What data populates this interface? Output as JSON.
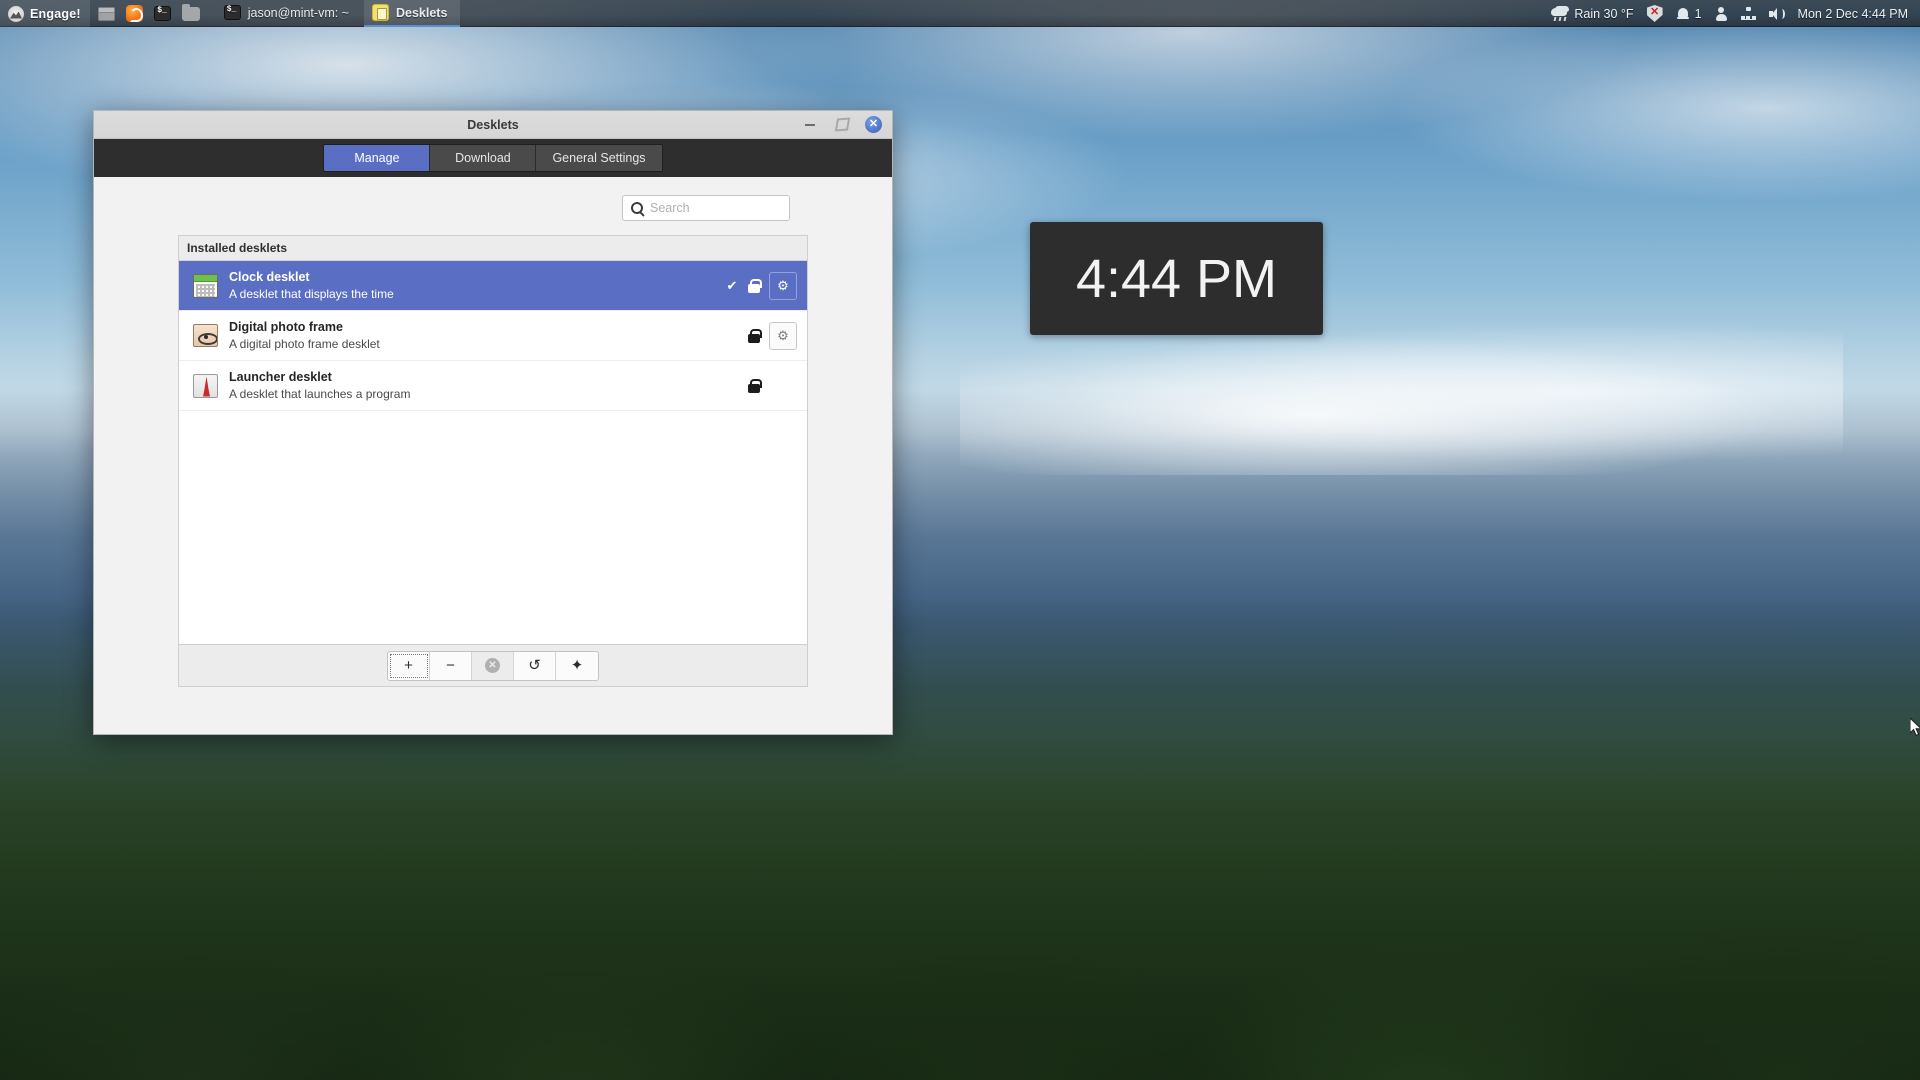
{
  "panel": {
    "menu": {
      "icon": "mint-menu-icon",
      "label": "Engage!"
    },
    "launchers": [
      {
        "name": "launcher-window-list",
        "icon": "window-icon"
      },
      {
        "name": "launcher-firefox",
        "icon": "firefox-icon"
      },
      {
        "name": "launcher-terminal",
        "icon": "terminal-icon"
      },
      {
        "name": "launcher-files",
        "icon": "folder-icon"
      }
    ],
    "windows": [
      {
        "name": "window-button-terminal",
        "icon": "terminal-icon",
        "label": "jason@mint-vm: ~",
        "active": false
      },
      {
        "name": "window-button-desklets",
        "icon": "desklets-icon",
        "label": "Desklets",
        "active": true
      }
    ],
    "tray": {
      "weather_icon": "cloud-rain-icon",
      "weather": "Rain 30 °F",
      "shield_icon": "shield-alert-icon",
      "notifications_icon": "bell-icon",
      "notifications_count": "1",
      "user_icon": "user-icon",
      "network_icon": "network-icon",
      "volume_icon": "volume-icon",
      "clock": "Mon  2 Dec  4:44 PM"
    }
  },
  "clock_desklet": {
    "time": "4:44 PM"
  },
  "window": {
    "title": "Desklets",
    "controls": {
      "minimize": "minimize-button",
      "maximize": "maximize-button",
      "close": "close-button"
    },
    "tabs": [
      {
        "label": "Manage",
        "active": true
      },
      {
        "label": "Download",
        "active": false
      },
      {
        "label": "General Settings",
        "active": false
      }
    ],
    "search": {
      "placeholder": "Search",
      "value": "",
      "icon": "search-icon"
    },
    "list": {
      "header": "Installed desklets",
      "rows": [
        {
          "icon": "clock-desklet-icon",
          "title": "Clock desklet",
          "description": "A desklet that displays the time",
          "selected": true,
          "checked": true,
          "check_glyph": "✔",
          "locked": true,
          "has_config": true,
          "gear_glyph": "⚙"
        },
        {
          "icon": "photo-frame-desklet-icon",
          "title": "Digital photo frame",
          "description": "A digital photo frame desklet",
          "selected": false,
          "checked": false,
          "check_glyph": "",
          "locked": true,
          "has_config": true,
          "gear_glyph": "⚙"
        },
        {
          "icon": "launcher-desklet-icon",
          "title": "Launcher desklet",
          "description": "A desklet that launches a program",
          "selected": false,
          "checked": false,
          "check_glyph": "",
          "locked": true,
          "has_config": false,
          "gear_glyph": ""
        }
      ]
    },
    "toolbar": [
      {
        "name": "add-desklet-button",
        "glyph": "+",
        "state": "focused"
      },
      {
        "name": "remove-desklet-button",
        "glyph": "−",
        "state": "normal"
      },
      {
        "name": "remove-all-button",
        "glyph": "⊗",
        "state": "disabled"
      },
      {
        "name": "restore-defaults-button",
        "glyph": "↺",
        "state": "normal"
      },
      {
        "name": "highlight-desklet-button",
        "glyph": "✦",
        "state": "normal"
      }
    ]
  },
  "colors": {
    "accent": "#5a6fc4",
    "panel": "#2b2f33",
    "window_bg": "#f2f2f2",
    "tabbar": "#2e2e2e",
    "desklet_bg": "#2d2d2d"
  }
}
